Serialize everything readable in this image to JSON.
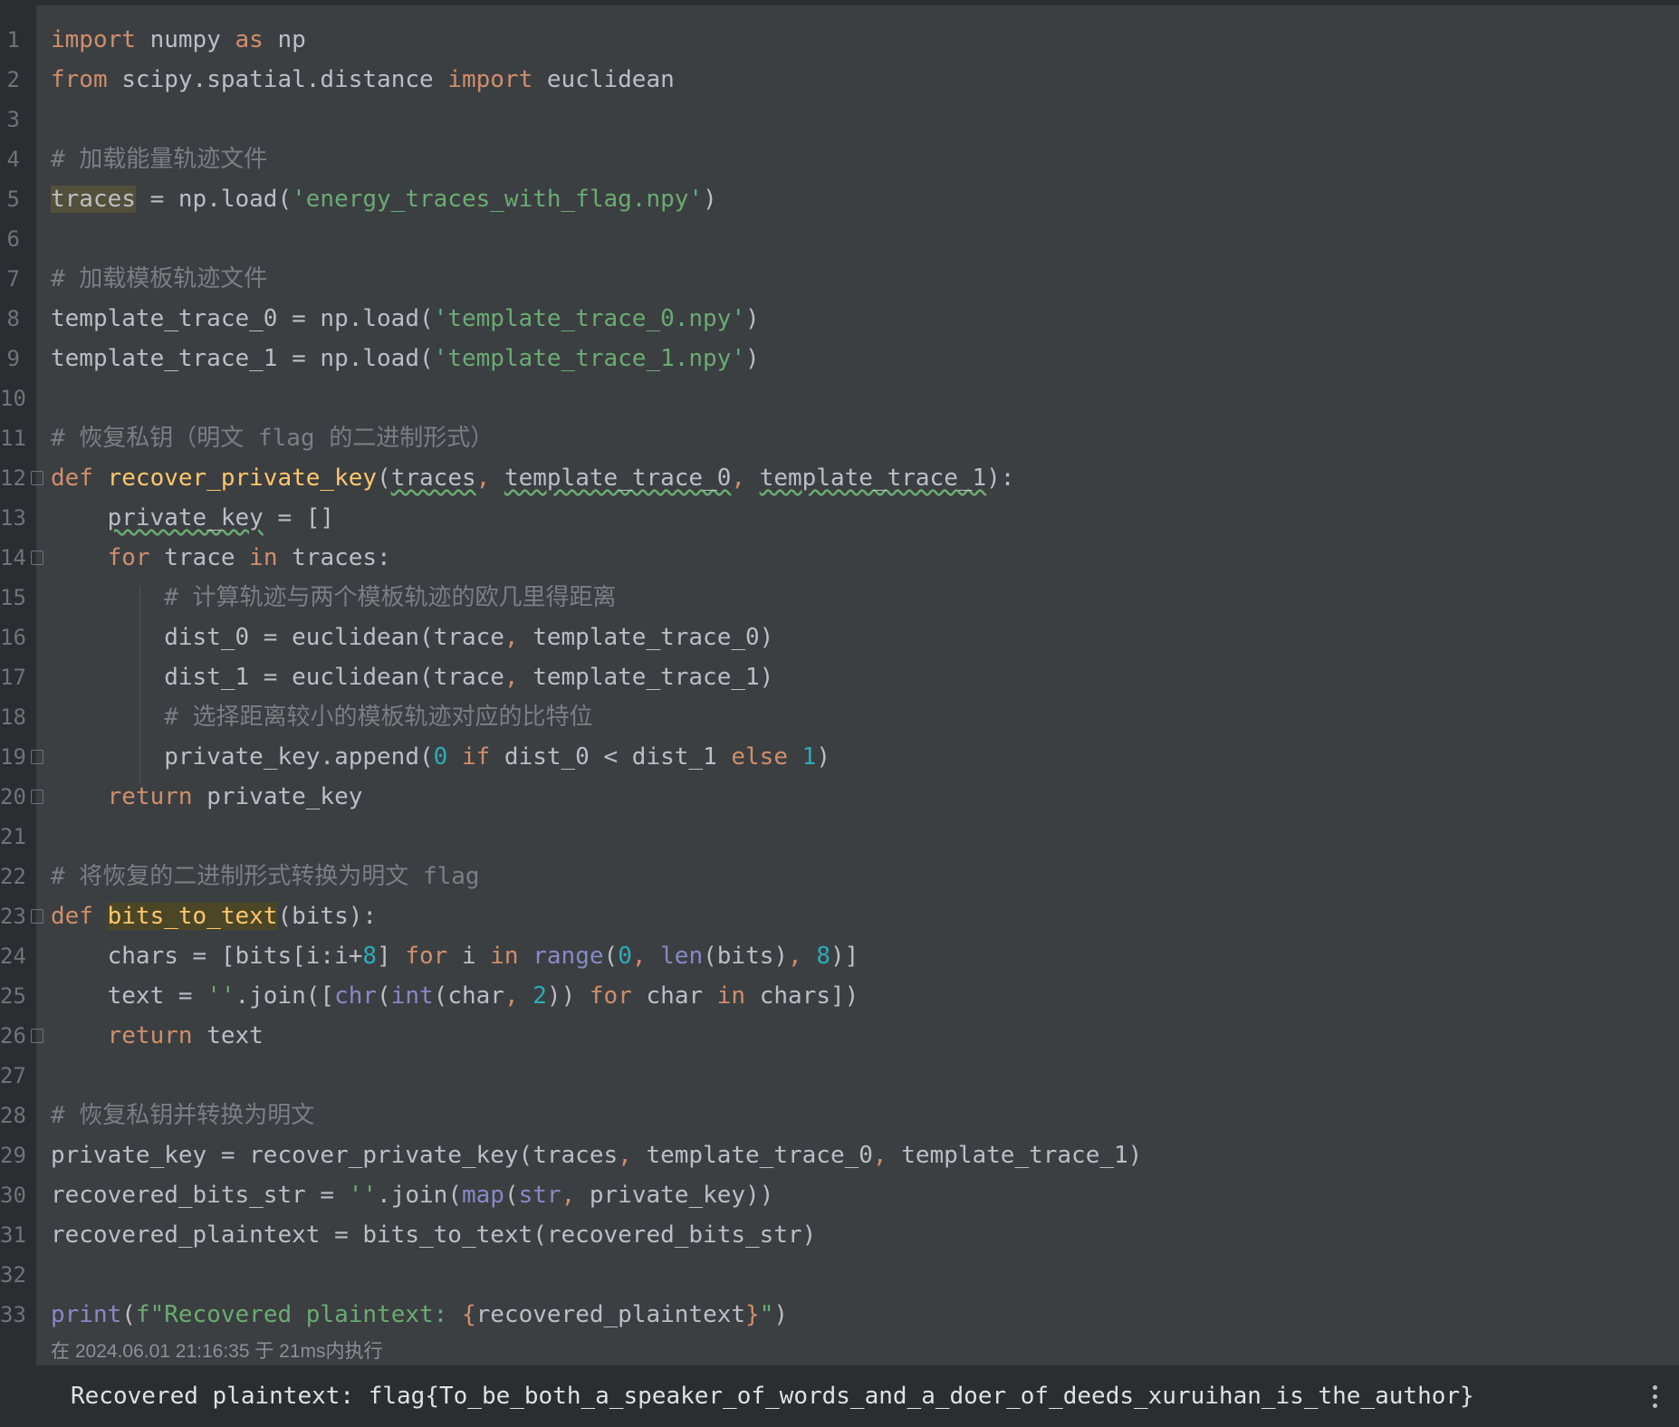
{
  "editor": {
    "lines": [
      {
        "n": "1"
      },
      {
        "n": "2"
      },
      {
        "n": "3"
      },
      {
        "n": "4"
      },
      {
        "n": "5"
      },
      {
        "n": "6"
      },
      {
        "n": "7"
      },
      {
        "n": "8"
      },
      {
        "n": "9"
      },
      {
        "n": "10"
      },
      {
        "n": "11"
      },
      {
        "n": "12"
      },
      {
        "n": "13"
      },
      {
        "n": "14"
      },
      {
        "n": "15"
      },
      {
        "n": "16"
      },
      {
        "n": "17"
      },
      {
        "n": "18"
      },
      {
        "n": "19"
      },
      {
        "n": "20"
      },
      {
        "n": "21"
      },
      {
        "n": "22"
      },
      {
        "n": "23"
      },
      {
        "n": "24"
      },
      {
        "n": "25"
      },
      {
        "n": "26"
      },
      {
        "n": "27"
      },
      {
        "n": "28"
      },
      {
        "n": "29"
      },
      {
        "n": "30"
      },
      {
        "n": "31"
      },
      {
        "n": "32"
      },
      {
        "n": "33"
      }
    ],
    "code": {
      "l1_import": "import",
      "l1_mod": " numpy ",
      "l1_as": "as",
      "l1_alias": " np",
      "l2_from": "from",
      "l2_mod": " scipy.spatial.distance ",
      "l2_import": "import",
      "l2_name": " euclidean",
      "l4_comment": "# 加载能量轨迹文件",
      "l5_var": "traces",
      "l5_mid": " = np.load(",
      "l5_str": "'energy_traces_with_flag.npy'",
      "l5_end": ")",
      "l7_comment": "# 加载模板轨迹文件",
      "l8_pre": "template_trace_0 = np.load(",
      "l8_str": "'template_trace_0.npy'",
      "l8_end": ")",
      "l9_pre": "template_trace_1 = np.load(",
      "l9_str": "'template_trace_1.npy'",
      "l9_end": ")",
      "l11_comment": "# 恢复私钥（明文 flag 的二进制形式）",
      "l12_def": "def ",
      "l12_fn": "recover_private_key",
      "l12_open": "(",
      "l12_p1": "traces",
      "l12_c1": ", ",
      "l12_p2": "template_trace_0",
      "l12_c2": ", ",
      "l12_p3": "template_trace_1",
      "l12_close": "):",
      "l13_indent": "    ",
      "l13_var": "private_key",
      "l13_rest": " = []",
      "l14_indent": "    ",
      "l14_for": "for",
      "l14_mid": " trace ",
      "l14_in": "in",
      "l14_rest": " traces:",
      "l15_indent": "        ",
      "l15_comment": "# 计算轨迹与两个模板轨迹的欧几里得距离",
      "l16_pre": "        dist_0 = euclidean(trace",
      "l16_c": ", ",
      "l16_rest": "template_trace_0)",
      "l17_pre": "        dist_1 = euclidean(trace",
      "l17_c": ", ",
      "l17_rest": "template_trace_1)",
      "l18_indent": "        ",
      "l18_comment": "# 选择距离较小的模板轨迹对应的比特位",
      "l19_pre": "        private_key.append(",
      "l19_n0": "0",
      "l19_sp1": " ",
      "l19_if": "if",
      "l19_mid": " dist_0 < dist_1 ",
      "l19_else": "else",
      "l19_sp2": " ",
      "l19_n1": "1",
      "l19_end": ")",
      "l20_indent": "    ",
      "l20_return": "return",
      "l20_rest": " private_key",
      "l22_comment": "# 将恢复的二进制形式转换为明文 flag",
      "l23_def": "def ",
      "l23_fn": "bits_to_text",
      "l23_rest": "(bits):",
      "l24_pre": "    chars = [bits[i:i+",
      "l24_n8": "8",
      "l24_b": "] ",
      "l24_for": "for",
      "l24_i": " i ",
      "l24_in": "in",
      "l24_sp": " ",
      "l24_range": "range",
      "l24_p": "(",
      "l24_n0": "0",
      "l24_c1": ", ",
      "l24_len": "len",
      "l24_bits": "(bits)",
      "l24_c2": ", ",
      "l24_n8b": "8",
      "l24_end": ")]",
      "l25_pre": "    text = ",
      "l25_str": "''",
      "l25_join": ".join([",
      "l25_chr": "chr",
      "l25_p": "(",
      "l25_int": "int",
      "l25_char": "(char",
      "l25_c": ", ",
      "l25_n2": "2",
      "l25_pp": ")) ",
      "l25_for": "for",
      "l25_mid": " char ",
      "l25_in": "in",
      "l25_end": " chars])",
      "l26_indent": "    ",
      "l26_return": "return",
      "l26_rest": " text",
      "l28_comment": "# 恢复私钥并转换为明文",
      "l29_pre": "private_key = recover_private_key(traces",
      "l29_c1": ", ",
      "l29_mid": "template_trace_0",
      "l29_c2": ", ",
      "l29_end": "template_trace_1)",
      "l30_pre": "recovered_bits_str = ",
      "l30_str": "''",
      "l30_join": ".join(",
      "l30_map": "map",
      "l30_p": "(",
      "l30_strb": "str",
      "l30_c": ", ",
      "l30_end": "private_key))",
      "l31_text": "recovered_plaintext = bits_to_text(recovered_bits_str)",
      "l33_print": "print",
      "l33_p": "(",
      "l33_f": "f\"Recovered plaintext: ",
      "l33_lb": "{",
      "l33_var": "recovered_plaintext",
      "l33_rb": "}",
      "l33_q": "\"",
      "l33_end": ")"
    },
    "exec_info": "在 2024.06.01 21:16:35 于 21ms内执行"
  },
  "output": {
    "text": "Recovered plaintext: flag{To_be_both_a_speaker_of_words_and_a_doer_of_deeds_xuruihan_is_the_author}"
  },
  "icons": {
    "more": "more-vertical-icon"
  },
  "colors": {
    "keyword": "#cf8e6d",
    "string": "#6aab73",
    "number": "#2aacb8",
    "comment": "#7a7e85",
    "function": "#ffc66d",
    "builtin": "#8888c6",
    "editor_bg": "#3c3f41"
  }
}
